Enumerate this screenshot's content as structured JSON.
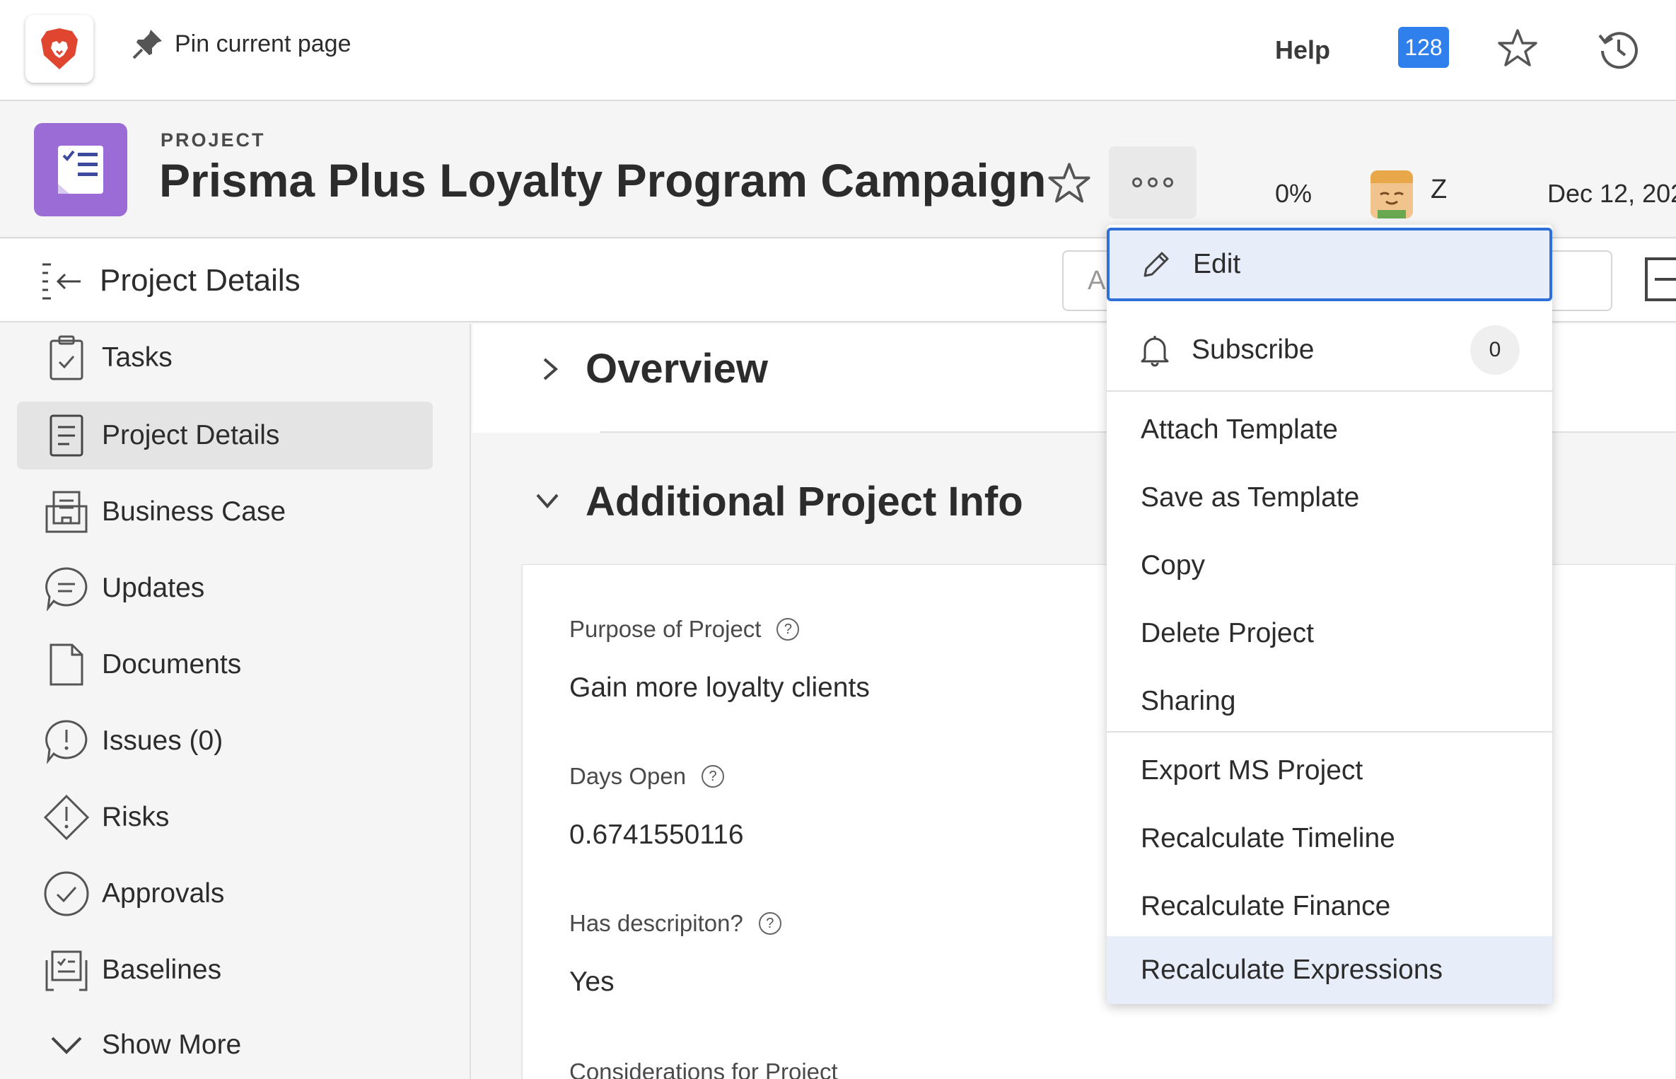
{
  "topbar": {
    "pin_label": "Pin current page",
    "help_label": "Help",
    "notification_count": "128",
    "brand_color": "#e0452f",
    "badge_color": "#2f80ed"
  },
  "project": {
    "type_label": "PROJECT",
    "title": "Prisma Plus Loyalty Program Campaign",
    "progress": "0%",
    "owner_initial": "Z",
    "due_date": "Dec 12, 202",
    "icon_color": "#9b6cd6"
  },
  "subheader": {
    "title": "Project Details",
    "search_placeholder": "A"
  },
  "sidebar": {
    "items": [
      {
        "label": "Tasks",
        "icon": "clipboard-check-icon"
      },
      {
        "label": "Project Details",
        "icon": "document-lines-icon",
        "active": true
      },
      {
        "label": "Business Case",
        "icon": "business-case-icon"
      },
      {
        "label": "Updates",
        "icon": "chat-bubble-icon"
      },
      {
        "label": "Documents",
        "icon": "document-icon"
      },
      {
        "label": "Issues (0)",
        "icon": "issue-bubble-icon"
      },
      {
        "label": "Risks",
        "icon": "risk-diamond-icon"
      },
      {
        "label": "Approvals",
        "icon": "check-circle-icon"
      },
      {
        "label": "Baselines",
        "icon": "baseline-icon"
      },
      {
        "label": "Show More",
        "icon": "chevron-down-icon"
      }
    ]
  },
  "main": {
    "overview_title": "Overview",
    "additional_title": "Additional Project Info",
    "fields": [
      {
        "label": "Purpose of Project",
        "value": "Gain more loyalty clients"
      },
      {
        "label": "Days Open",
        "value": "0.6741550116"
      },
      {
        "label": "Has descripiton?",
        "value": "Yes"
      },
      {
        "label": "Considerations for Project",
        "value": ""
      }
    ]
  },
  "menu": {
    "edit": "Edit",
    "subscribe": "Subscribe",
    "subscribe_count": "0",
    "items_group1": [
      "Attach Template",
      "Save as Template",
      "Copy",
      "Delete Project",
      "Sharing"
    ],
    "items_group2": [
      "Export MS Project",
      "Recalculate Timeline",
      "Recalculate Finance",
      "Recalculate Expressions"
    ],
    "highlight_color": "#e8eef9",
    "focus_color": "#2f6fd8"
  }
}
